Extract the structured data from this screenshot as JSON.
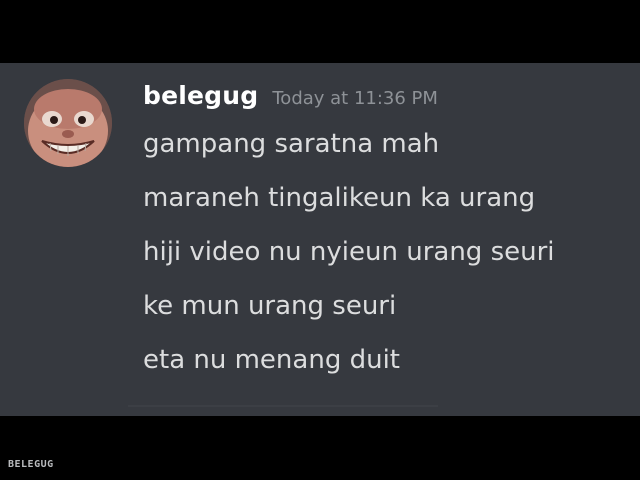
{
  "message": {
    "username": "belegug",
    "timestamp": "Today at 11:36 PM",
    "lines": [
      "gampang saratna mah",
      "maraneh tingalikeun ka urang",
      "hiji video nu nyieun urang seuri",
      "ke mun urang seuri",
      "eta nu menang duit"
    ],
    "avatar_icon": "smiling-face-avatar"
  },
  "watermark": "BELEGUG",
  "colors": {
    "background": "#000000",
    "chat_background": "#36393f",
    "username": "#ffffff",
    "timestamp": "#8e9297",
    "message_text": "#dcddde"
  }
}
